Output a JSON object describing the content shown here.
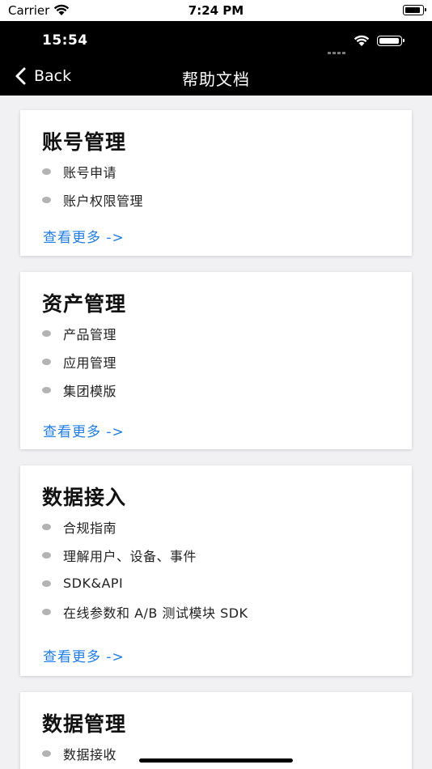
{
  "device_status": {
    "carrier": "Carrier",
    "time": "7:24 PM",
    "icons": [
      "wifi-icon",
      "battery-icon"
    ]
  },
  "app_status": {
    "time": "15:54",
    "icons": [
      "signal-dots-icon",
      "wifi-icon",
      "battery-icon"
    ]
  },
  "nav": {
    "back_label": "Back",
    "title": "帮助文档",
    "back_icon": "chevron-left-icon"
  },
  "colors": {
    "header_bg": "#000000",
    "page_bg": "#f1f1f4",
    "link": "#1f7de8",
    "bullet": "#b3b3b3"
  },
  "sections": [
    {
      "title": "账号管理",
      "items": [
        "账号申请",
        "账户权限管理"
      ],
      "more_label": "查看更多 ->"
    },
    {
      "title": "资产管理",
      "items": [
        "产品管理",
        "应用管理",
        "集团模版"
      ],
      "more_label": "查看更多 ->"
    },
    {
      "title": "数据接入",
      "items": [
        "合规指南",
        "理解用户、设备、事件",
        "SDK&API",
        "在线参数和 A/B 测试模块 SDK"
      ],
      "more_label": "查看更多 ->"
    },
    {
      "title": "数据管理",
      "items": [
        "数据接收"
      ],
      "more_label": ""
    }
  ]
}
